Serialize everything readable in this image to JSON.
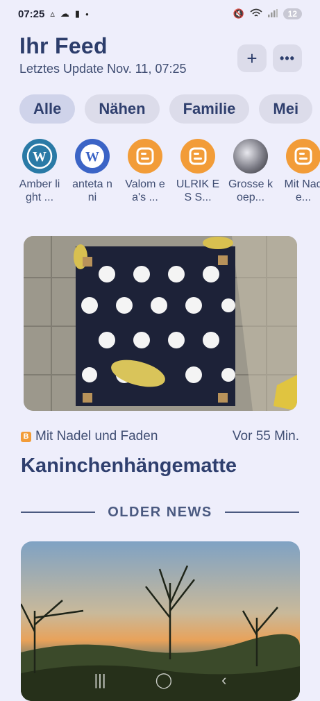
{
  "status_bar": {
    "time": "07:25",
    "left_icons": [
      "vpn-icon",
      "cloud-icon",
      "battery-icon",
      "dot-icon"
    ],
    "right_icons": [
      "mute-icon",
      "wifi-icon",
      "signal-icon"
    ],
    "battery_level": "12"
  },
  "header": {
    "title": "Ihr Feed",
    "subtitle": "Letztes Update Nov. 11, 07:25",
    "add_button": "+",
    "more_button": "•••"
  },
  "chips": [
    "Alle",
    "Nähen",
    "Familie",
    "Mei"
  ],
  "feeds": [
    {
      "label": "Amber light ...",
      "icon": "wordpress-icon",
      "color": "#2a7aa6",
      "glyph": "W"
    },
    {
      "label": "anteta nni",
      "icon": "wordpress-icon",
      "color": "#3b64c6",
      "glyph": "W"
    },
    {
      "label": "Valom ea's ...",
      "icon": "blogger-icon",
      "color": "#f29c38",
      "glyph": "B"
    },
    {
      "label": "ULRIK ES S...",
      "icon": "blogger-icon",
      "color": "#f29c38",
      "glyph": "B"
    },
    {
      "label": "Grosse koep...",
      "icon": "avatar-icon",
      "color": "#8f8f96",
      "glyph": ""
    },
    {
      "label": "Mit Nade...",
      "icon": "blogger-icon",
      "color": "#f29c38",
      "glyph": "B"
    }
  ],
  "article": {
    "source": "Mit Nadel und Faden",
    "source_icon": "blogger-icon",
    "time": "Vor 55 Min.",
    "title": "Kaninchenhängematte"
  },
  "section_divider": "OLDER NEWS",
  "nav_bar": {
    "recent": "|||",
    "home": "◯",
    "back": "‹"
  },
  "colors": {
    "background": "#eeeefb",
    "text_primary": "#2f3f6e",
    "chip_bg": "#dcdcea",
    "blogger_orange": "#f29c38",
    "wordpress_blue": "#2a7aa6"
  }
}
